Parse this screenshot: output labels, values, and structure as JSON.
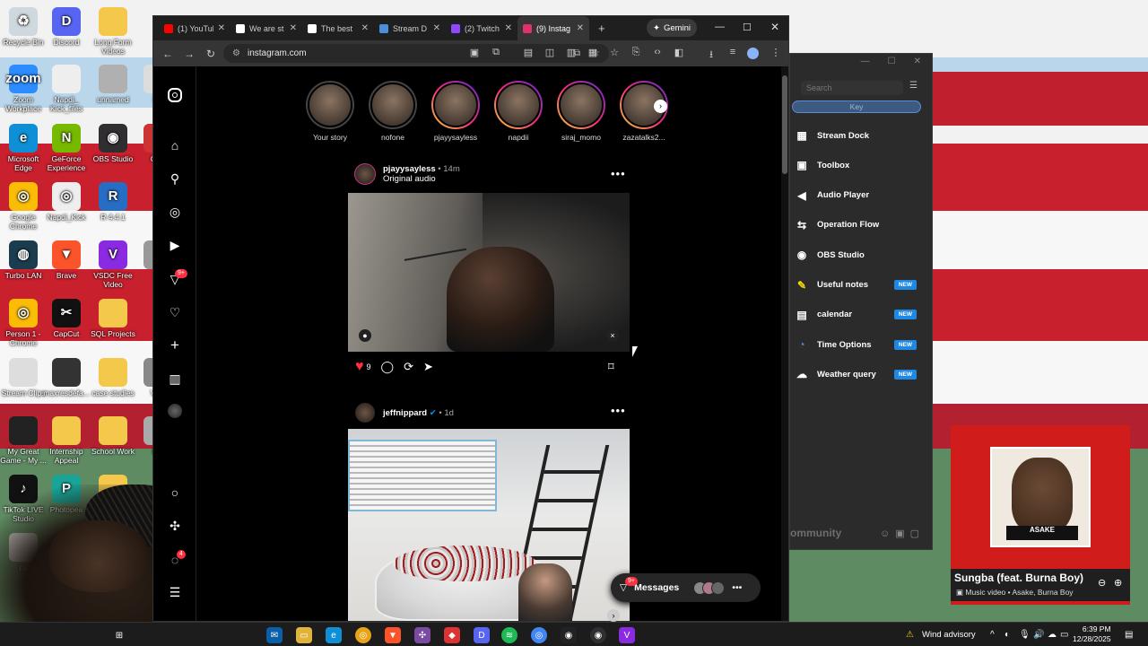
{
  "desktop": {
    "icons": [
      {
        "label": "Recycle Bin",
        "icon": "recycle-bin-icon",
        "color": "#cfd8dc",
        "glyph": "♻"
      },
      {
        "label": "Discord",
        "icon": "discord-icon",
        "color": "#5865f2",
        "glyph": "D"
      },
      {
        "label": "Long Form Videos",
        "icon": "folder-icon",
        "color": "#f4c84a",
        "glyph": ""
      },
      {
        "label": "Zoom Workplace",
        "icon": "zoom-icon",
        "color": "#2d8cff",
        "glyph": "zoom"
      },
      {
        "label": "Napdi_ Kick_files",
        "icon": "file-icon",
        "color": "#eeeeee",
        "glyph": ""
      },
      {
        "label": "unnamed",
        "icon": "image-file-icon",
        "color": "#b0b0b0",
        "glyph": ""
      },
      {
        "label": "SS",
        "icon": "file-icon",
        "color": "#dddddd",
        "glyph": ""
      },
      {
        "label": "Microsoft Edge",
        "icon": "edge-icon",
        "color": "#0f8fd6",
        "glyph": "e"
      },
      {
        "label": "GeForce Experience",
        "icon": "nvidia-icon",
        "color": "#76b900",
        "glyph": "N"
      },
      {
        "label": "OBS Studio",
        "icon": "obs-icon",
        "color": "#302e31",
        "glyph": "◉"
      },
      {
        "label": "Cisc",
        "icon": "cisco-icon",
        "color": "#c33",
        "glyph": ""
      },
      {
        "label": "Google Chrome",
        "icon": "chrome-icon",
        "color": "#fbbc05",
        "glyph": "◎"
      },
      {
        "label": "Napdi_Kick",
        "icon": "chrome-file-icon",
        "color": "#eeeeee",
        "glyph": "◎"
      },
      {
        "label": "R 4.4.1",
        "icon": "r-icon",
        "color": "#276dc3",
        "glyph": "R"
      },
      {
        "label": "Turbo LAN",
        "icon": "turbolan-icon",
        "color": "#1b3c4f",
        "glyph": "◍"
      },
      {
        "label": "Brave",
        "icon": "brave-icon",
        "color": "#fb542b",
        "glyph": "▼"
      },
      {
        "label": "VSDC Free Video",
        "icon": "vsdc-icon",
        "color": "#8a2be2",
        "glyph": "V"
      },
      {
        "label": "S4",
        "icon": "file-icon",
        "color": "#999",
        "glyph": ""
      },
      {
        "label": "Person 1 - Chrome",
        "icon": "chrome-icon",
        "color": "#fbbc05",
        "glyph": "◎"
      },
      {
        "label": "CapCut",
        "icon": "capcut-icon",
        "color": "#111111",
        "glyph": "✂"
      },
      {
        "label": "SQL Projects",
        "icon": "folder-icon",
        "color": "#f4c84a",
        "glyph": ""
      },
      {
        "label": "Stream Clips",
        "icon": "file-icon",
        "color": "#ddd",
        "glyph": ""
      },
      {
        "label": "maxresdefa...",
        "icon": "image-file-icon",
        "color": "#333",
        "glyph": ""
      },
      {
        "label": "case studies",
        "icon": "folder-icon",
        "color": "#f4c84a",
        "glyph": ""
      },
      {
        "label": "Visu",
        "icon": "file-icon",
        "color": "#888",
        "glyph": ""
      },
      {
        "label": "My Great Game - My ...",
        "icon": "shortcut-icon",
        "color": "#222",
        "glyph": ""
      },
      {
        "label": "Internship Appeal",
        "icon": "folder-icon",
        "color": "#f4c84a",
        "glyph": ""
      },
      {
        "label": "School Work",
        "icon": "folder-icon",
        "color": "#f4c84a",
        "glyph": ""
      },
      {
        "label": "Ele",
        "icon": "file-icon",
        "color": "#aaa",
        "glyph": ""
      },
      {
        "label": "TikTok LIVE Studio",
        "icon": "tiktok-icon",
        "color": "#111",
        "glyph": "♪"
      },
      {
        "label": "Photopea",
        "icon": "photopea-icon",
        "color": "#18a497",
        "glyph": "P"
      },
      {
        "label": "school assignments",
        "icon": "folder-icon",
        "color": "#f4c84a",
        "glyph": ""
      },
      {
        "label": "La",
        "icon": "file-icon",
        "color": "#ccc",
        "glyph": ""
      },
      {
        "label": "Ma",
        "icon": "excel-icon",
        "color": "#1d6f42",
        "glyph": "X"
      },
      {
        "label": "Roblo",
        "icon": "roblox-icon",
        "color": "#333",
        "glyph": ""
      }
    ]
  },
  "browser": {
    "tabs": [
      {
        "title": "(1) YouTube",
        "favicon": "youtube-icon",
        "color": "#ff0000"
      },
      {
        "title": "We are st",
        "favicon": "mail-icon",
        "color": "#ffffff"
      },
      {
        "title": "The best",
        "favicon": "diamond-icon",
        "color": "#ffffff"
      },
      {
        "title": "Stream D",
        "favicon": "streamdock-icon",
        "color": "#4a90d9"
      },
      {
        "title": "(2) Twitch",
        "favicon": "twitch-icon",
        "color": "#9146ff"
      },
      {
        "title": "(9) Instag",
        "favicon": "instagram-icon",
        "color": "#e1306c"
      }
    ],
    "new_tab": "+",
    "gemini_label": "Gemini",
    "url": "instagram.com"
  },
  "instagram": {
    "stories": [
      {
        "name": "Your story",
        "seen": true
      },
      {
        "name": "nofone",
        "seen": true
      },
      {
        "name": "pjayysayless",
        "seen": false
      },
      {
        "name": "napdii",
        "seen": false
      },
      {
        "name": "siraj_momo",
        "seen": false
      },
      {
        "name": "zazatalks2...",
        "seen": false
      }
    ],
    "sidebar_badges": {
      "notifications": "9+",
      "messages": "4"
    },
    "post1": {
      "username": "pjayysayless",
      "age": "14m",
      "audio": "Original audio",
      "likes": "9"
    },
    "post2": {
      "username": "jeffnippard",
      "age": "1d",
      "verified": true
    },
    "messages_label": "Messages",
    "messages_badge": "9+"
  },
  "stream_dock": {
    "search_placeholder": "Search",
    "key_label": "Key",
    "items": [
      {
        "label": "Stream Dock",
        "icon": "grid-icon",
        "new": false
      },
      {
        "label": "Toolbox",
        "icon": "toolbox-icon",
        "new": false
      },
      {
        "label": "Audio Player",
        "icon": "speaker-icon",
        "new": false
      },
      {
        "label": "Operation Flow",
        "icon": "flow-icon",
        "new": false
      },
      {
        "label": "OBS Studio",
        "icon": "obs-icon",
        "new": false
      },
      {
        "label": "Useful notes",
        "icon": "notes-icon",
        "new": true
      },
      {
        "label": "calendar",
        "icon": "calendar-icon",
        "new": true
      },
      {
        "label": "Time Options",
        "icon": "clock-icon",
        "new": true
      },
      {
        "label": "Weather query",
        "icon": "weather-icon",
        "new": true
      }
    ],
    "new_label": "NEW",
    "community_label": "ommunity"
  },
  "media": {
    "title": "Sungba (feat. Burna Boy)",
    "subtitle": "Music video • Asake, Burna Boy",
    "plate": "ASAKE"
  },
  "taskbar": {
    "weather": "Wind advisory",
    "time": "6:39 PM",
    "date": "12/28/2025"
  }
}
